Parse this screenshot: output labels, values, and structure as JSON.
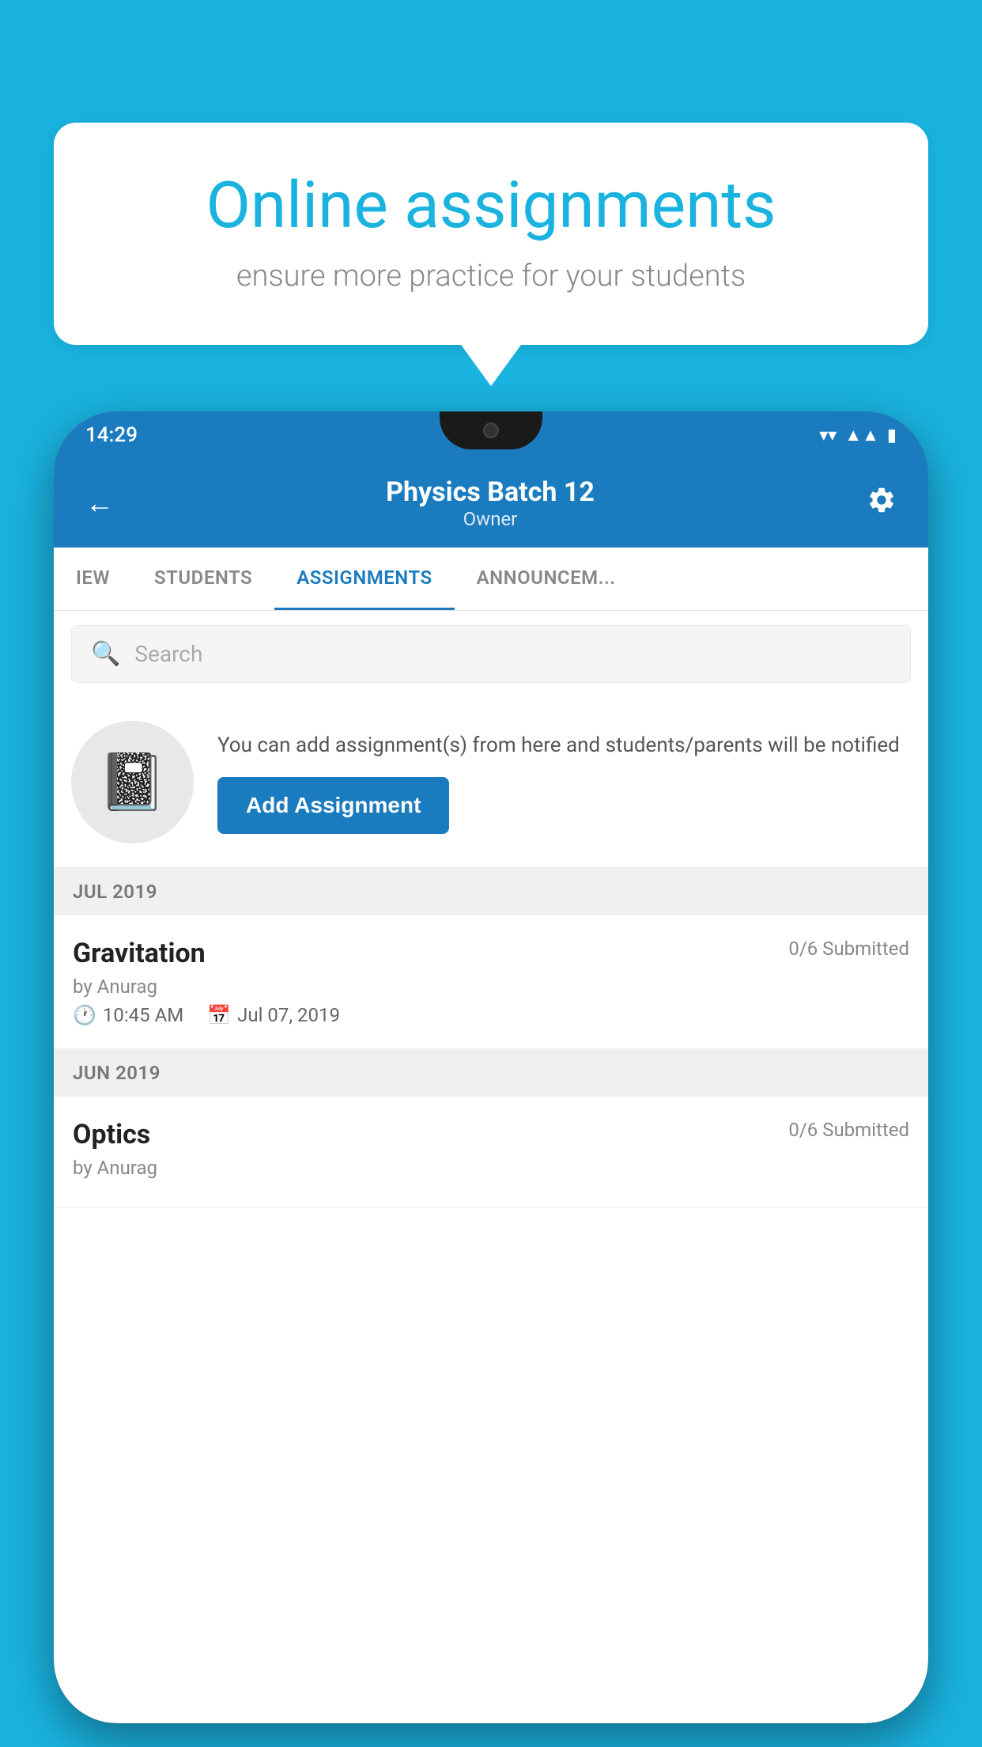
{
  "background_color": "#1ab3e0",
  "speech_bubble": {
    "title": "Online assignments",
    "subtitle": "ensure more practice for your students"
  },
  "status_bar": {
    "time": "14:29",
    "icons": [
      "wifi",
      "signal",
      "battery"
    ]
  },
  "app_header": {
    "title": "Physics Batch 12",
    "subtitle": "Owner",
    "back_label": "←",
    "settings_label": "⚙"
  },
  "tabs": [
    {
      "label": "IEW",
      "active": false
    },
    {
      "label": "STUDENTS",
      "active": false
    },
    {
      "label": "ASSIGNMENTS",
      "active": true
    },
    {
      "label": "ANNOUNCEM...",
      "active": false
    }
  ],
  "search": {
    "placeholder": "Search"
  },
  "info_section": {
    "description": "You can add assignment(s) from here and students/parents will be notified",
    "add_button_label": "Add Assignment"
  },
  "sections": [
    {
      "header": "JUL 2019",
      "assignments": [
        {
          "title": "Gravitation",
          "submitted": "0/6 Submitted",
          "by": "by Anurag",
          "time": "10:45 AM",
          "date": "Jul 07, 2019"
        }
      ]
    },
    {
      "header": "JUN 2019",
      "assignments": [
        {
          "title": "Optics",
          "submitted": "0/6 Submitted",
          "by": "by Anurag",
          "time": "",
          "date": ""
        }
      ]
    }
  ]
}
